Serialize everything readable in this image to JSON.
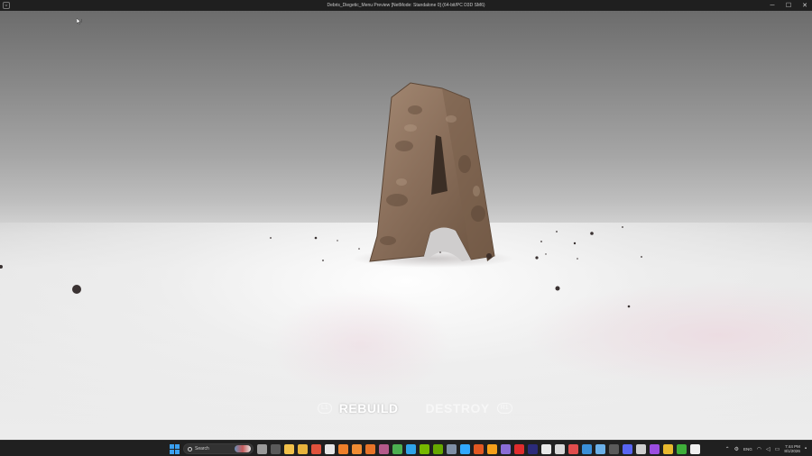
{
  "window": {
    "title": "Debris_Diegetic_Menu Preview [NetMode: Standalone 0]  (64-bit/PC D3D SM6)",
    "app_icon": "U",
    "controls": [
      "─",
      "☐",
      "✕"
    ]
  },
  "menu": {
    "left_key": "L1",
    "items": [
      {
        "label": "REBUILD",
        "state": "active"
      },
      {
        "label": "DESTROY",
        "state": "inactive"
      }
    ],
    "right_key": "R1"
  },
  "taskbar": {
    "search_placeholder": "Search",
    "apps": [
      {
        "name": "task-view",
        "color": "#9a9a9a"
      },
      {
        "name": "widgets",
        "color": "#5a5a5a"
      },
      {
        "name": "file-explorer",
        "color": "#f2c14a"
      },
      {
        "name": "folder",
        "color": "#e8b33c"
      },
      {
        "name": "chrome",
        "color": "#e0523c"
      },
      {
        "name": "unity",
        "color": "#e6e6e6"
      },
      {
        "name": "blender",
        "color": "#ee7f2a"
      },
      {
        "name": "blender-alt",
        "color": "#f08c33"
      },
      {
        "name": "blender-beta",
        "color": "#e87428"
      },
      {
        "name": "media",
        "color": "#b45a8a"
      },
      {
        "name": "terminal",
        "color": "#4caf50"
      },
      {
        "name": "photoshop",
        "color": "#2fa3e8"
      },
      {
        "name": "nvidia",
        "color": "#76b900"
      },
      {
        "name": "nvidia-broadcast",
        "color": "#66a800"
      },
      {
        "name": "tools",
        "color": "#7f8fa6"
      },
      {
        "name": "photoshop-2",
        "color": "#31a8ff"
      },
      {
        "name": "app-orange",
        "color": "#e25822"
      },
      {
        "name": "substance",
        "color": "#f6a01a"
      },
      {
        "name": "obs",
        "color": "#8a6cd6"
      },
      {
        "name": "acrobat",
        "color": "#e02d2d"
      },
      {
        "name": "premiere",
        "color": "#2b2b7a"
      },
      {
        "name": "unreal",
        "color": "#e8e8e8"
      },
      {
        "name": "epic",
        "color": "#d8d8d8"
      },
      {
        "name": "notifications-app",
        "color": "#e14d4d"
      },
      {
        "name": "store",
        "color": "#3a8fd8"
      },
      {
        "name": "notepad",
        "color": "#6bb0e8"
      },
      {
        "name": "calculator",
        "color": "#5a5a5a"
      },
      {
        "name": "discord",
        "color": "#5865f2"
      },
      {
        "name": "steam",
        "color": "#cfcfcf"
      },
      {
        "name": "app-purple",
        "color": "#9b4de0"
      },
      {
        "name": "app-yellow",
        "color": "#e8b92e"
      },
      {
        "name": "xbox",
        "color": "#3fae3a"
      },
      {
        "name": "unreal-editor",
        "color": "#f0f0f0"
      }
    ],
    "tray": {
      "language": "ENG",
      "time": "7:44 PM",
      "date": "8/1/2026"
    }
  },
  "icons": {
    "cursor": "mouse-cursor-icon",
    "search": "search-icon",
    "start": "windows-start-icon"
  },
  "colors": {
    "menu_active": "#ffffff",
    "menu_inactive": "#ffffff8c",
    "letter": "#8a705c"
  }
}
